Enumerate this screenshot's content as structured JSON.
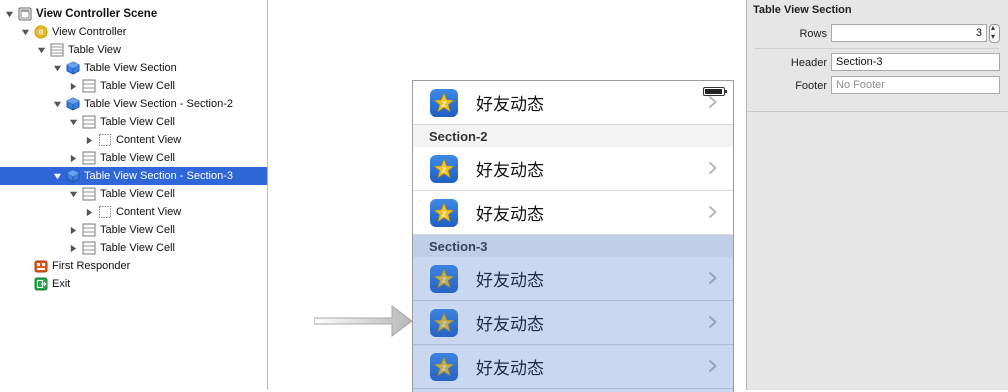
{
  "outline": {
    "items": [
      {
        "label": "View Controller Scene",
        "indent": 0,
        "disclosure": "open",
        "icon": "scene-icon",
        "bold": true
      },
      {
        "label": "View Controller",
        "indent": 1,
        "disclosure": "open",
        "icon": "view-controller-icon",
        "bold": false
      },
      {
        "label": "Table View",
        "indent": 2,
        "disclosure": "open",
        "icon": "table-view-icon",
        "bold": false
      },
      {
        "label": "Table View Section",
        "indent": 3,
        "disclosure": "open",
        "icon": "table-section-icon",
        "bold": false
      },
      {
        "label": "Table View Cell",
        "indent": 4,
        "disclosure": "closed",
        "icon": "table-cell-icon",
        "bold": false
      },
      {
        "label": "Table View Section - Section-2",
        "indent": 3,
        "disclosure": "open",
        "icon": "table-section-icon",
        "bold": false
      },
      {
        "label": "Table View Cell",
        "indent": 4,
        "disclosure": "open",
        "icon": "table-cell-icon",
        "bold": false
      },
      {
        "label": "Content View",
        "indent": 5,
        "disclosure": "closed",
        "icon": "content-view-icon",
        "bold": false
      },
      {
        "label": "Table View Cell",
        "indent": 4,
        "disclosure": "closed",
        "icon": "table-cell-icon",
        "bold": false
      },
      {
        "label": "Table View Section - Section-3",
        "indent": 3,
        "disclosure": "open",
        "icon": "table-section-icon",
        "bold": false,
        "selected": true
      },
      {
        "label": "Table View Cell",
        "indent": 4,
        "disclosure": "open",
        "icon": "table-cell-icon",
        "bold": false
      },
      {
        "label": "Content View",
        "indent": 5,
        "disclosure": "closed",
        "icon": "content-view-icon",
        "bold": false
      },
      {
        "label": "Table View Cell",
        "indent": 4,
        "disclosure": "closed",
        "icon": "table-cell-icon",
        "bold": false
      },
      {
        "label": "Table View Cell",
        "indent": 4,
        "disclosure": "closed",
        "icon": "table-cell-icon",
        "bold": false
      },
      {
        "label": "First Responder",
        "indent": 1,
        "disclosure": "none",
        "icon": "first-responder-icon",
        "bold": false
      },
      {
        "label": "Exit",
        "indent": 1,
        "disclosure": "none",
        "icon": "exit-icon",
        "bold": false
      }
    ]
  },
  "canvas": {
    "cells": [
      {
        "title": "好友动态",
        "selected": false
      },
      {
        "section_header": "Section-2"
      },
      {
        "title": "好友动态",
        "selected": false
      },
      {
        "title": "好友动态",
        "selected": false
      },
      {
        "section_header": "Section-3"
      },
      {
        "title": "好友动态",
        "selected": true
      },
      {
        "title": "好友动态",
        "selected": true
      },
      {
        "title": "好友动态",
        "selected": true
      }
    ]
  },
  "inspector": {
    "title": "Table View Section",
    "rows_label": "Rows",
    "rows_value": "3",
    "header_label": "Header",
    "header_value": "Section-3",
    "footer_label": "Footer",
    "footer_placeholder": "No Footer"
  },
  "colors": {
    "selection": "#2f67d8",
    "icon_blue": "#2f74d8",
    "star_yellow": "#f4c21b"
  }
}
